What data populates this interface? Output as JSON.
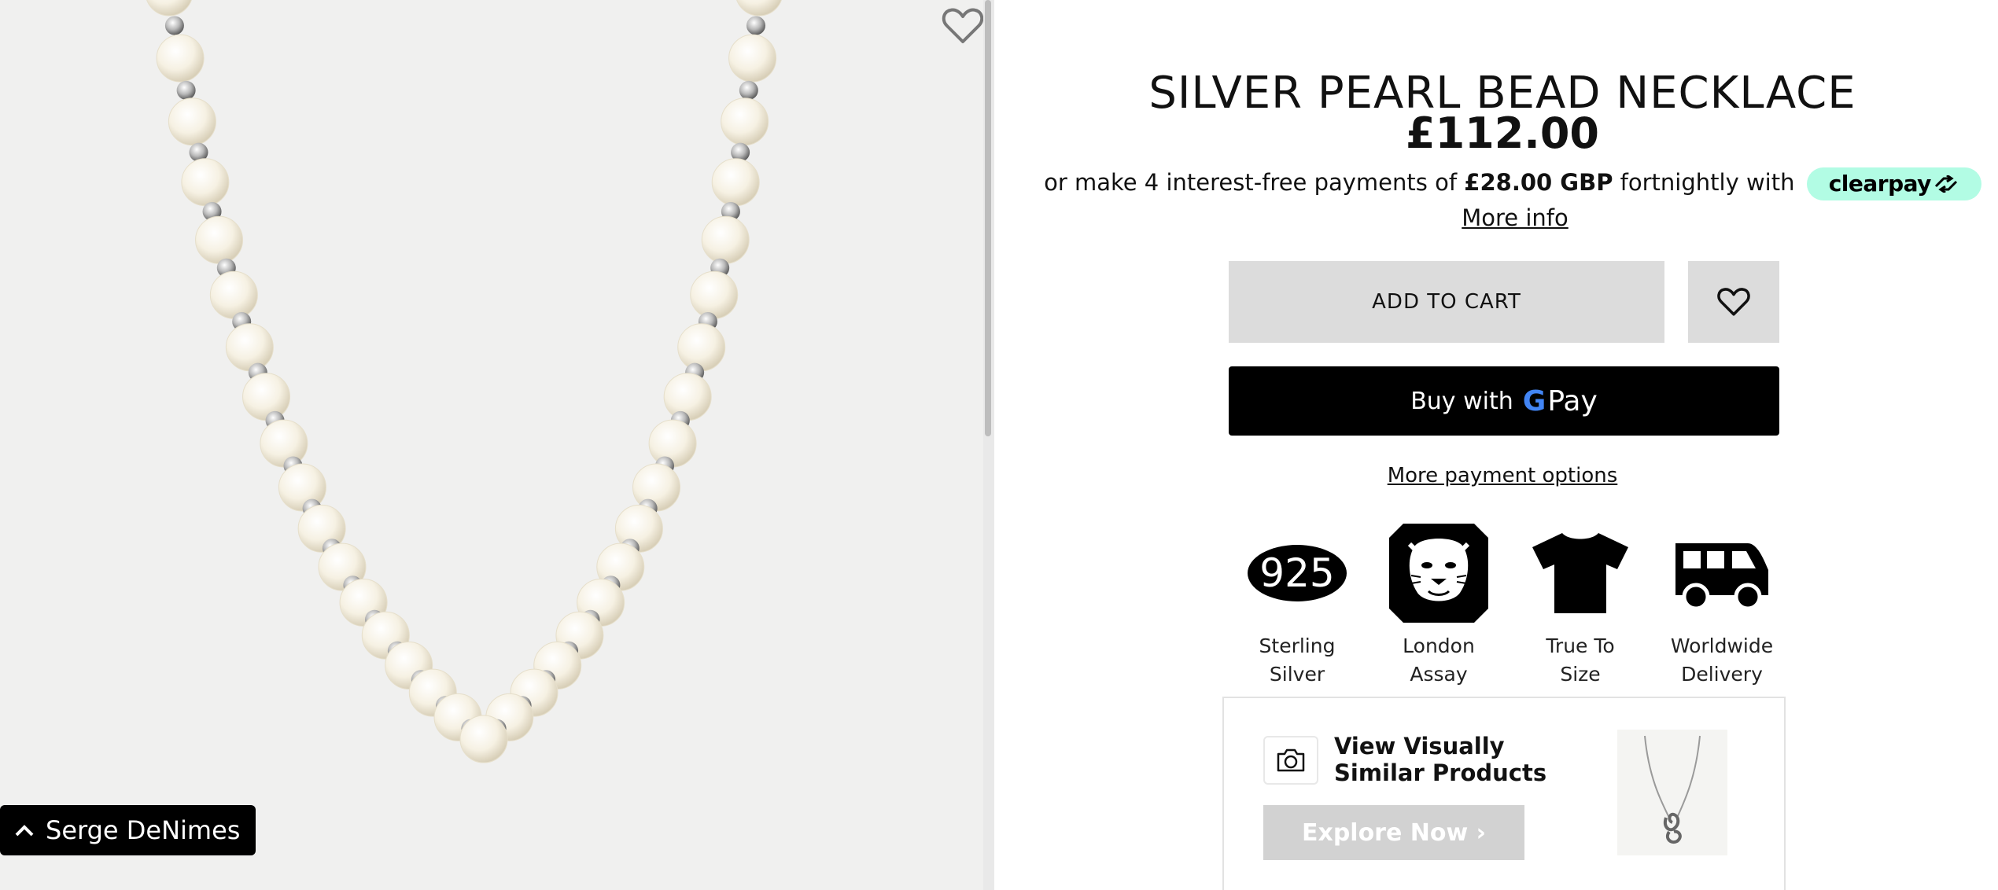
{
  "gallery": {
    "brand_chip": {
      "label": "Serge DeNimes",
      "icon": "chevron-up-icon"
    },
    "wishlist_icon": "heart-outline-icon"
  },
  "product": {
    "title": "SILVER PEARL BEAD NECKLACE",
    "price": "£112.00",
    "installments": {
      "prefix": "or make 4 interest-free payments of ",
      "amount": "£28.00 GBP",
      "suffix": " fortnightly with ",
      "provider": "clearpay",
      "more_info": "More info"
    },
    "add_to_cart": "ADD TO CART",
    "gpay": {
      "prefix": "Buy with",
      "g": "G",
      "pay": "Pay"
    },
    "more_payment_options": "More payment options",
    "features": [
      {
        "icon": "sterling-925-icon",
        "badge_text": "925",
        "label_line1": "Sterling",
        "label_line2": "Silver"
      },
      {
        "icon": "lion-head-icon",
        "label_line1": "London",
        "label_line2": "Assay"
      },
      {
        "icon": "tshirt-icon",
        "label_line1": "True To",
        "label_line2": "Size"
      },
      {
        "icon": "delivery-van-icon",
        "label_line1": "Worldwide",
        "label_line2": "Delivery"
      }
    ],
    "visual_search": {
      "title_line1": "View Visually",
      "title_line2": "Similar Products",
      "cta": "Explore Now ›"
    }
  },
  "colors": {
    "clearpay_mint": "#b2fce4",
    "button_grey": "#dcdcdc",
    "gpay_black": "#000000",
    "gallery_bg": "#f0f0ef"
  }
}
